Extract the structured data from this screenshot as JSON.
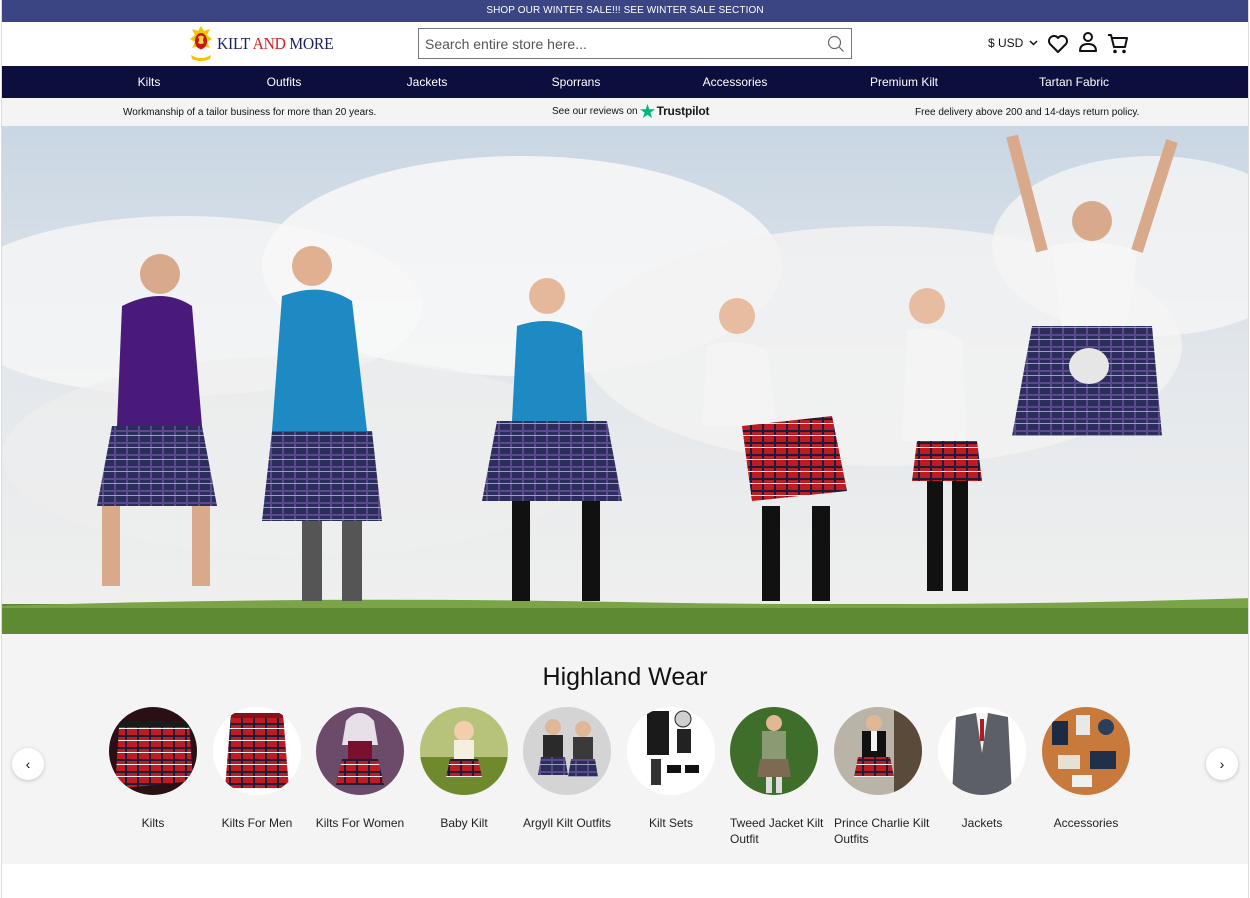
{
  "promo": {
    "text": "SHOP OUR WINTER SALE!!! SEE WINTER SALE SECTION"
  },
  "header": {
    "logo": {
      "part1": "KILT ",
      "part2": "AND",
      "part3": " MORE"
    },
    "search": {
      "placeholder": "Search entire store here...",
      "value": ""
    },
    "currency": "$ USD",
    "icons": [
      "search-icon",
      "chevron-down-icon",
      "heart-icon",
      "user-icon",
      "cart-icon"
    ]
  },
  "nav": {
    "items": [
      {
        "label": "Kilts"
      },
      {
        "label": "Outfits"
      },
      {
        "label": "Jackets"
      },
      {
        "label": "Sporrans"
      },
      {
        "label": "Accessories"
      },
      {
        "label": "Premium Kilt"
      },
      {
        "label": "Tartan Fabric"
      }
    ]
  },
  "usp": {
    "left": "Workmanship of a tailor business for more than 20 years.",
    "middle_prefix": "See our reviews on",
    "middle_brand": "Trustpilot",
    "right": "Free delivery above 200 and 14-days return policy."
  },
  "highland": {
    "title": "Highland Wear",
    "prev": "‹",
    "next": "›",
    "categories": [
      {
        "label": "Kilts"
      },
      {
        "label": "Kilts For Men"
      },
      {
        "label": "Kilts For Women"
      },
      {
        "label": "Baby Kilt"
      },
      {
        "label": "Argyll Kilt Outfits"
      },
      {
        "label": "Kilt Sets"
      },
      {
        "label": "Tweed Jacket Kilt Outfit"
      },
      {
        "label": "Prince Charlie Kilt Outfits"
      },
      {
        "label": "Jackets"
      },
      {
        "label": "Accessories"
      }
    ]
  },
  "colors": {
    "promo_bg": "#3b4583",
    "nav_bg": "#0c0f3d",
    "brand_red": "#d21f1f",
    "trustpilot_green": "#00b67a"
  }
}
